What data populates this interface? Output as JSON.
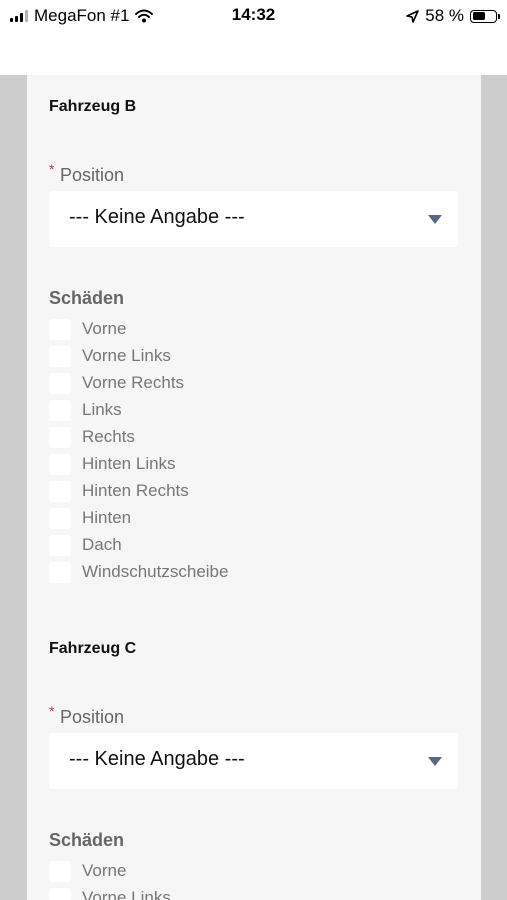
{
  "status_bar": {
    "carrier": "MegaFon #1",
    "time": "14:32",
    "battery": "58 %",
    "battery_level": 0.58
  },
  "vehicle_b": {
    "title": "Fahrzeug B",
    "position_label": "Position",
    "required_mark": "*",
    "select_value": "--- Keine Angabe ---",
    "damage_title": "Schäden",
    "damages": [
      "Vorne",
      "Vorne Links",
      "Vorne Rechts",
      "Links",
      "Rechts",
      "Hinten Links",
      "Hinten Rechts",
      "Hinten",
      "Dach",
      "Windschutzscheibe"
    ]
  },
  "vehicle_c": {
    "title": "Fahrzeug C",
    "position_label": "Position",
    "required_mark": "*",
    "select_value": "--- Keine Angabe ---",
    "damage_title": "Schäden",
    "damages": [
      "Vorne",
      "Vorne Links"
    ]
  }
}
